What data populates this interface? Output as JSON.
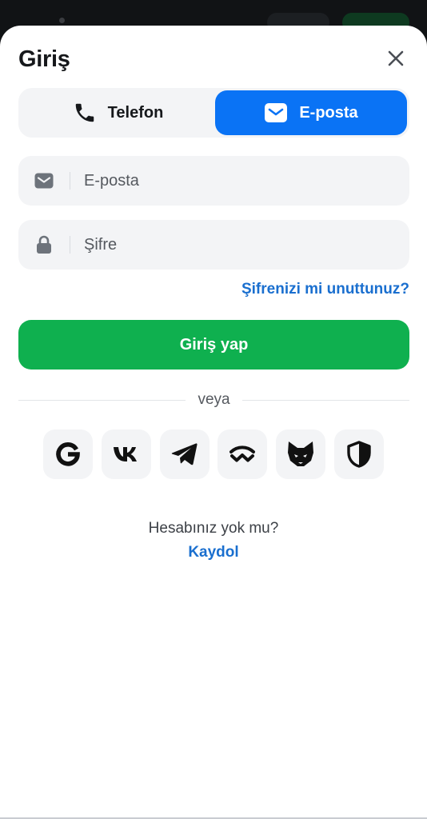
{
  "dialog": {
    "title": "Giriş"
  },
  "tabs": {
    "phone_label": "Telefon",
    "email_label": "E-posta",
    "active": "email"
  },
  "form": {
    "email_placeholder": "E-posta",
    "email_value": "",
    "password_placeholder": "Şifre",
    "password_value": "",
    "forgot_label": "Şifrenizi mi unuttunuz?",
    "submit_label": "Giriş yap"
  },
  "divider": {
    "label": "veya"
  },
  "social": [
    {
      "icon": "google-icon"
    },
    {
      "icon": "vk-icon"
    },
    {
      "icon": "telegram-icon"
    },
    {
      "icon": "walletconnect-icon"
    },
    {
      "icon": "metamask-fox-icon"
    },
    {
      "icon": "shield-icon"
    }
  ],
  "footer": {
    "prompt": "Hesabınız yok mu?",
    "signup_label": "Kaydol"
  },
  "colors": {
    "accent_blue": "#0a73f5",
    "link_blue": "#1a6fcf",
    "primary_green": "#0fb04f",
    "field_bg": "#f3f4f6",
    "text_dark": "#16181b"
  }
}
